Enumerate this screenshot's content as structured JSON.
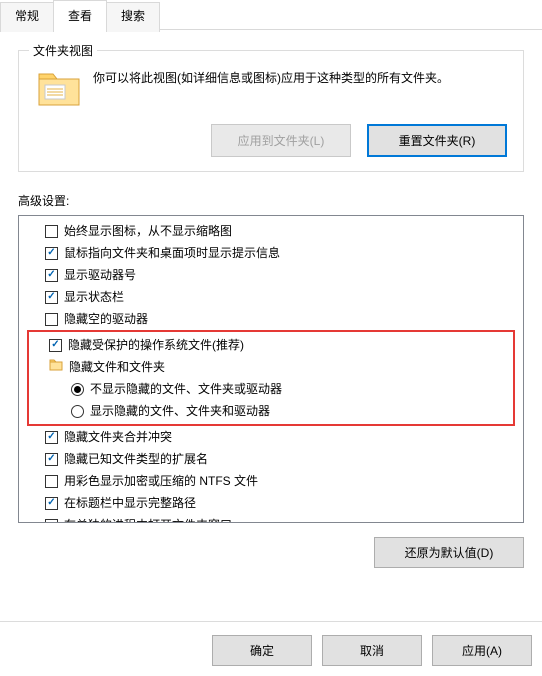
{
  "tabs": {
    "general": "常规",
    "view": "查看",
    "search": "搜索"
  },
  "folder_view": {
    "title": "文件夹视图",
    "desc": "你可以将此视图(如详细信息或图标)应用于这种类型的所有文件夹。",
    "apply_btn": "应用到文件夹(L)",
    "reset_btn": "重置文件夹(R)"
  },
  "advanced": {
    "label": "高级设置:",
    "items": [
      {
        "kind": "check",
        "checked": false,
        "indent": 1,
        "text": "始终显示图标，从不显示缩略图"
      },
      {
        "kind": "check",
        "checked": true,
        "indent": 1,
        "text": "鼠标指向文件夹和桌面项时显示提示信息"
      },
      {
        "kind": "check",
        "checked": true,
        "indent": 1,
        "text": "显示驱动器号"
      },
      {
        "kind": "check",
        "checked": true,
        "indent": 1,
        "text": "显示状态栏"
      },
      {
        "kind": "check",
        "checked": false,
        "indent": 1,
        "text": "隐藏空的驱动器"
      },
      {
        "kind": "group_start"
      },
      {
        "kind": "check",
        "checked": true,
        "indent": 1,
        "text": "隐藏受保护的操作系统文件(推荐)"
      },
      {
        "kind": "folder",
        "indent": 1,
        "text": "隐藏文件和文件夹"
      },
      {
        "kind": "radio",
        "checked": true,
        "indent": 2,
        "text": "不显示隐藏的文件、文件夹或驱动器"
      },
      {
        "kind": "radio",
        "checked": false,
        "indent": 2,
        "text": "显示隐藏的文件、文件夹和驱动器"
      },
      {
        "kind": "group_end"
      },
      {
        "kind": "check",
        "checked": true,
        "indent": 1,
        "text": "隐藏文件夹合并冲突"
      },
      {
        "kind": "check",
        "checked": true,
        "indent": 1,
        "text": "隐藏已知文件类型的扩展名"
      },
      {
        "kind": "check",
        "checked": false,
        "indent": 1,
        "text": "用彩色显示加密或压缩的 NTFS 文件"
      },
      {
        "kind": "check",
        "checked": true,
        "indent": 1,
        "text": "在标题栏中显示完整路径"
      },
      {
        "kind": "check",
        "checked": false,
        "indent": 1,
        "text": "在单独的进程中打开文件夹窗口",
        "cutoff": true
      }
    ],
    "restore_btn": "还原为默认值(D)"
  },
  "dialog": {
    "ok": "确定",
    "cancel": "取消",
    "apply": "应用(A)"
  }
}
